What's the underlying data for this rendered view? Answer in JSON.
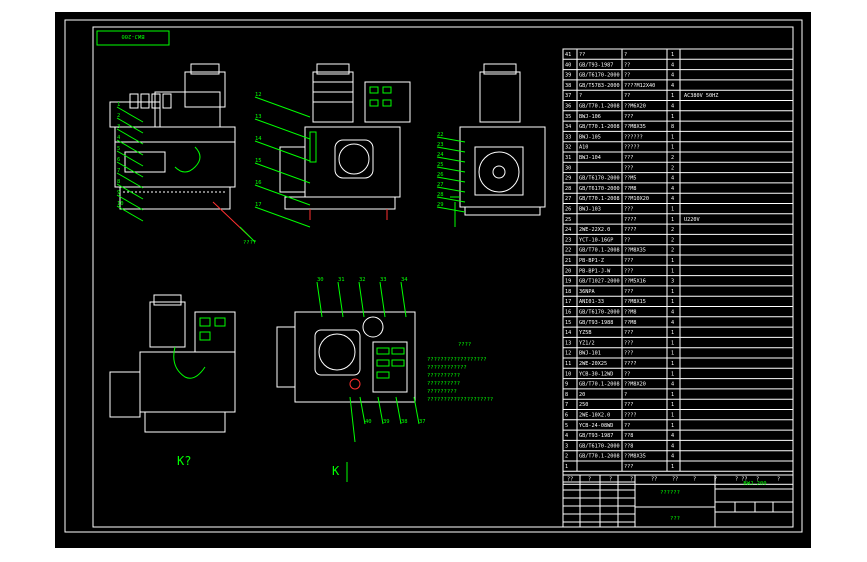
{
  "drawing": {
    "stamp": "BWJ-200",
    "title_block_name": "BWJ-200",
    "title_block_center": "??????",
    "title_block_bottom": "???",
    "view_label_left": "K?",
    "view_label_right": "K",
    "note_title": "????",
    "notes": [
      "??????????????????",
      "????????????",
      "??????????",
      "??????????",
      "?????????",
      "????????????????????"
    ],
    "left_callout_label": "????",
    "top_callouts": [
      "12",
      "13",
      "14",
      "15",
      "16",
      "17"
    ],
    "right_callouts": [
      "22",
      "23",
      "24",
      "25",
      "26",
      "27",
      "28",
      "29"
    ],
    "plan_callouts_top": [
      "30",
      "31",
      "32",
      "33",
      "34"
    ],
    "plan_callouts_bottom": [
      "40",
      "39",
      "38",
      "37"
    ],
    "left_view_callouts": [
      "1",
      "2",
      "3",
      "4",
      "5",
      "6",
      "7",
      "8",
      "9",
      "10"
    ]
  },
  "bom": {
    "rows": [
      [
        "41",
        "??",
        "?",
        "1",
        ""
      ],
      [
        "40",
        "GB/T93-1987",
        "??",
        "4",
        ""
      ],
      [
        "39",
        "GB/T6170-2000",
        "??",
        "4",
        ""
      ],
      [
        "38",
        "GB/T5783-2000",
        "????M12X40",
        "4",
        ""
      ],
      [
        "37",
        "?",
        "??",
        "1",
        "AC380V 50HZ"
      ],
      [
        "36",
        "GB/T70.1-2008",
        "??M6X20",
        "4",
        ""
      ],
      [
        "35",
        "BWJ-106",
        "???",
        "1",
        ""
      ],
      [
        "34",
        "GB/T70.1-2008",
        "??M8X35",
        "8",
        ""
      ],
      [
        "33",
        "BWJ-105",
        "??????",
        "1",
        ""
      ],
      [
        "32",
        "A10",
        "?????",
        "1",
        ""
      ],
      [
        "31",
        "BWJ-104",
        "???",
        "2",
        ""
      ],
      [
        "30",
        "",
        "???",
        "2",
        ""
      ],
      [
        "29",
        "GB/T6170-2000",
        "??M5",
        "4",
        ""
      ],
      [
        "28",
        "GB/T6170-2000",
        "??M8",
        "4",
        ""
      ],
      [
        "27",
        "GB/T70.1-2008",
        "??M10X20",
        "4",
        ""
      ],
      [
        "26",
        "BWJ-103",
        "???",
        "1",
        ""
      ],
      [
        "25",
        "",
        "????",
        "1",
        "U220V"
      ],
      [
        "24",
        "2WE-22X2.0",
        "????",
        "2",
        ""
      ],
      [
        "23",
        "YCT-10-16GP",
        "??",
        "2",
        ""
      ],
      [
        "22",
        "GB/T70.1-2008",
        "??M8X35",
        "2",
        ""
      ],
      [
        "21",
        "PB-BP1-Z",
        "???",
        "1",
        ""
      ],
      [
        "20",
        "PB-BP1-J-W",
        "???",
        "1",
        ""
      ],
      [
        "19",
        "GB/T1027-2000",
        "??M5X16",
        "3",
        ""
      ],
      [
        "18",
        "36NPA",
        "???",
        "1",
        ""
      ],
      [
        "17",
        "ANI01-33",
        "??M8X15",
        "1",
        ""
      ],
      [
        "16",
        "GB/T6170-2000",
        "??M8",
        "4",
        ""
      ],
      [
        "15",
        "GB/T93-1988",
        "??M8",
        "4",
        ""
      ],
      [
        "14",
        "YZ5B",
        "???",
        "1",
        ""
      ],
      [
        "13",
        "YZ1/2",
        "???",
        "1",
        ""
      ],
      [
        "12",
        "BWJ-101",
        "???",
        "1",
        ""
      ],
      [
        "11",
        "2WE-20X25",
        "????",
        "1",
        ""
      ],
      [
        "10",
        "YCB-30-12WD",
        "??",
        "1",
        ""
      ],
      [
        "9",
        "GB/T70.1-2008",
        "??M8X20",
        "4",
        ""
      ],
      [
        "8",
        "20",
        "?",
        "1",
        ""
      ],
      [
        "7",
        "250",
        "???",
        "1",
        ""
      ],
      [
        "6",
        "2WE-10X2.0",
        "????",
        "1",
        ""
      ],
      [
        "5",
        "YCB-24-08WD",
        "??",
        "1",
        ""
      ],
      [
        "4",
        "GB/T93-1987",
        "??8",
        "4",
        ""
      ],
      [
        "3",
        "GB/T6170-2000",
        "??8",
        "4",
        ""
      ],
      [
        "2",
        "GB/T70.1-2008",
        "??M8X35",
        "4",
        ""
      ],
      [
        "1",
        "",
        "???",
        "1",
        ""
      ]
    ],
    "header": [
      "??",
      "?",
      "?",
      "?",
      "??",
      "??",
      "?",
      "?",
      "? ??",
      "?",
      "?"
    ]
  },
  "colors": {
    "background": "#000000",
    "frame": "#ffffff",
    "callout": "#00ff00",
    "hidden_line": "#ff3030"
  }
}
